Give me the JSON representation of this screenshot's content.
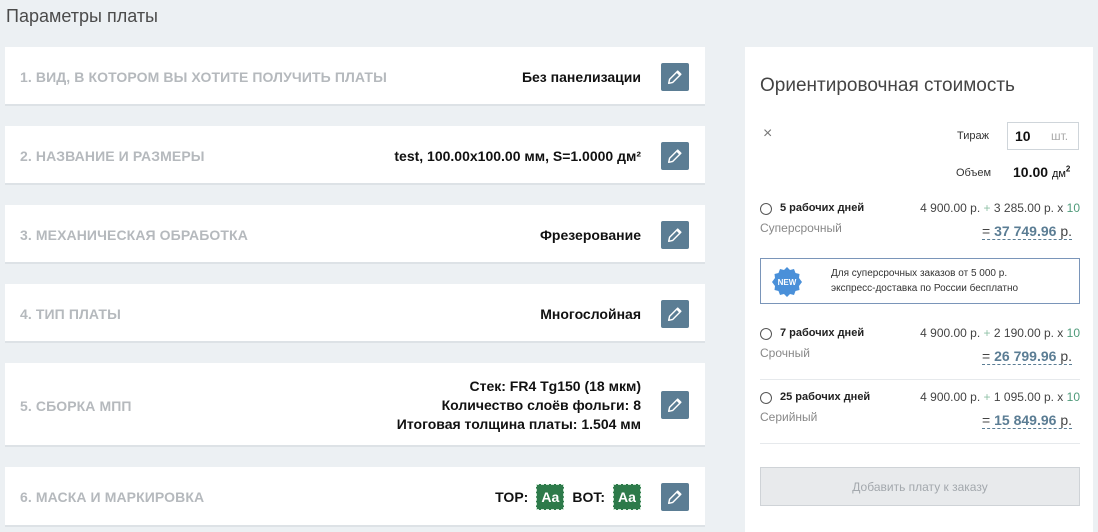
{
  "page_title": "Параметры платы",
  "steps": [
    {
      "label": "1. ВИД, В КОТОРОМ ВЫ ХОТИТЕ ПОЛУЧИТЬ ПЛАТЫ",
      "value": "Без панелизации"
    },
    {
      "label": "2. НАЗВАНИЕ И РАЗМЕРЫ",
      "value": "test, 100.00х100.00 мм, S=1.0000 дм²"
    },
    {
      "label": "3. МЕХАНИЧЕСКАЯ ОБРАБОТКА",
      "value": "Фрезерование"
    },
    {
      "label": "4. ТИП ПЛАТЫ",
      "value": "Многослойная"
    },
    {
      "label": "5. СБОРКА МПП",
      "lines": [
        "Стек: FR4 Tg150 (18 мкм)",
        "Количество слоёв фольги: 8",
        "Итоговая толщина платы: 1.504 мм"
      ]
    },
    {
      "label": "6. МАСКА И МАРКИРОВКА",
      "top_label": "TOP:",
      "bot_label": "BOT:",
      "swatch_text": "Aa",
      "swatch_color": "#2d7a4a"
    }
  ],
  "icons": {
    "edit": "pencil-icon",
    "close": "close-icon",
    "new": "new-badge-icon"
  },
  "cost_panel": {
    "title": "Ориентировочная стоимость",
    "close_glyph": "×",
    "quantity_label": "Тираж",
    "quantity_value": "10",
    "quantity_unit": "шт.",
    "volume_label": "Объем",
    "volume_value": "10.00",
    "volume_unit": "дм",
    "volume_exp": "2",
    "options": [
      {
        "days": "5 рабочих дней",
        "type": "Суперсрочный",
        "base": "4 900.00 р.",
        "per_unit": "3 285.00 р.",
        "qty": "10",
        "total": "37 749.96",
        "currency": "р."
      },
      {
        "days": "7 рабочих дней",
        "type": "Срочный",
        "base": "4 900.00 р.",
        "per_unit": "2 190.00 р.",
        "qty": "10",
        "total": "26 799.96",
        "currency": "р."
      },
      {
        "days": "25 рабочих дней",
        "type": "Серийный",
        "base": "4 900.00 р.",
        "per_unit": "1 095.00 р.",
        "qty": "10",
        "total": "15 849.96",
        "currency": "р."
      }
    ],
    "promo": {
      "badge": "NEW",
      "line1": "Для суперсрочных заказов от 5 000 р.",
      "line2": "экспресс-доставка по России бесплатно"
    },
    "add_button": "Добавить плату к заказу"
  },
  "colors": {
    "accent": "#5b7d94",
    "badge": "#4a90d9",
    "mask": "#2d7a4a"
  }
}
